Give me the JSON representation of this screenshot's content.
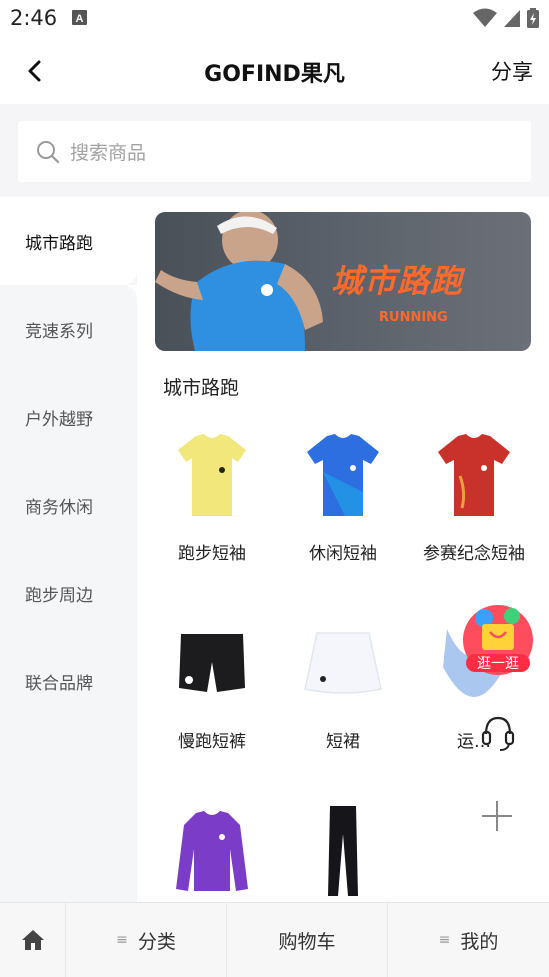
{
  "status_bar": {
    "time": "2:46"
  },
  "header": {
    "title": "GOFIND果凡",
    "share_label": "分享"
  },
  "search": {
    "placeholder": "搜索商品"
  },
  "sidebar": {
    "items": [
      {
        "label": "城市路跑",
        "active": true
      },
      {
        "label": "竞速系列",
        "active": false
      },
      {
        "label": "户外越野",
        "active": false
      },
      {
        "label": "商务休闲",
        "active": false
      },
      {
        "label": "跑步周边",
        "active": false
      },
      {
        "label": "联合品牌",
        "active": false
      }
    ]
  },
  "banner": {
    "title": "城市路跑",
    "subtitle": "RUNNING"
  },
  "section": {
    "title": "城市路跑"
  },
  "products": [
    {
      "label": "跑步短袖",
      "icon": "yellow-tshirt"
    },
    {
      "label": "休闲短袖",
      "icon": "blue-tshirt"
    },
    {
      "label": "参赛纪念短袖",
      "icon": "red-tshirt"
    },
    {
      "label": "慢跑短裤",
      "icon": "black-shorts"
    },
    {
      "label": "短裙",
      "icon": "white-skirt"
    },
    {
      "label": "运…",
      "icon": "sports-bra"
    },
    {
      "label": "",
      "icon": "purple-longsleeve"
    },
    {
      "label": "",
      "icon": "black-leggings"
    }
  ],
  "floating": {
    "shop_badge": "逛一逛"
  },
  "bottom_nav": {
    "category_label": "分类",
    "cart_label": "购物车",
    "me_label": "我的"
  },
  "colors": {
    "accent_orange": "#ff6a2c",
    "sidebar_bg": "#f5f6f8"
  }
}
